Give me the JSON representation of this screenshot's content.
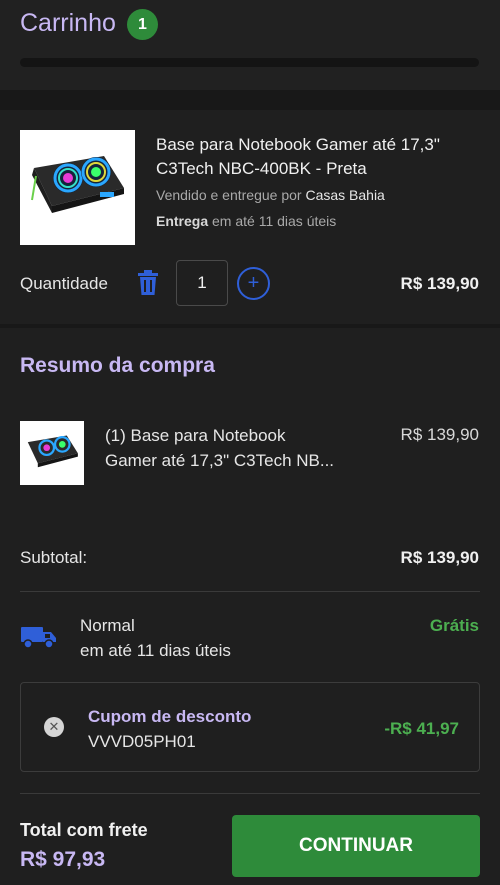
{
  "header": {
    "title": "Carrinho",
    "badge_count": "1"
  },
  "item": {
    "name_line1": "Base para Notebook Gamer até 17,3\"",
    "name_line2": "C3Tech NBC-400BK - Preta",
    "seller_prefix": "Vendido e entregue por",
    "seller_name": "Casas Bahia",
    "delivery_label": "Entrega",
    "delivery_text": "em até 11 dias úteis",
    "quantity_label": "Quantidade",
    "quantity_value": "1",
    "price": "R$ 139,90",
    "icon_trash": "trash-icon",
    "icon_plus": "plus-icon"
  },
  "summary": {
    "title": "Resumo da compra",
    "item_line1": "(1) Base para Notebook",
    "item_line2": "Gamer até 17,3\" C3Tech NB...",
    "item_price": "R$ 139,90",
    "subtotal_label": "Subtotal:",
    "subtotal_value": "R$ 139,90",
    "shipping": {
      "name": "Normal",
      "eta": "em até 11 dias úteis",
      "price": "Grátis",
      "icon": "truck-icon"
    },
    "coupon": {
      "title": "Cupom de desconto",
      "code": "VVVD05PH01",
      "discount": "-R$ 41,97",
      "remove_icon": "close-icon"
    },
    "total_label": "Total com frete",
    "total_value": "R$ 97,93",
    "continue_label": "CONTINUAR"
  },
  "colors": {
    "accent_purple": "#c8b8f3",
    "green": "#2e8b3a",
    "blue": "#2f5fd8",
    "price_green": "#4caf50"
  }
}
